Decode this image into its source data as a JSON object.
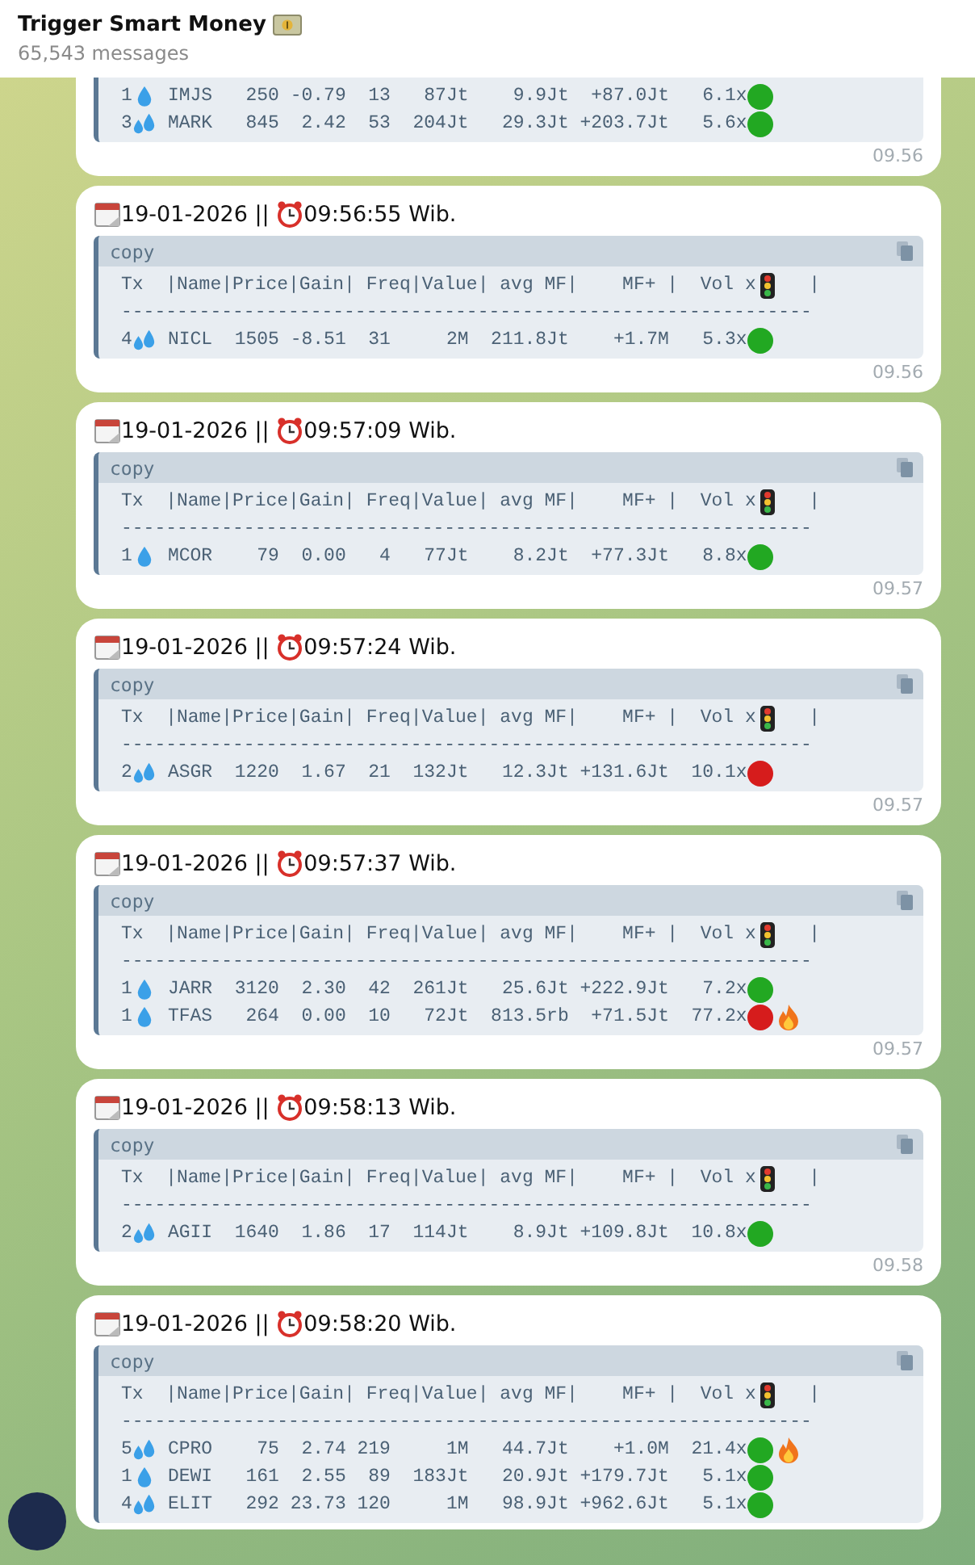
{
  "chat": {
    "title": "Trigger Smart Money",
    "subtitle": "65,543 messages"
  },
  "messages": [
    {
      "partial": true,
      "rows": [
        {
          "tx": "1",
          "kind": "drop",
          "name": "IMJS",
          "price": "250",
          "gain": "-0.79",
          "freq": "13",
          "value": "87Jt",
          "avg_mf": "9.9Jt",
          "mf_plus": "+87.0Jt",
          "vol": "6.1x",
          "color": "#22a822",
          "fire": false
        },
        {
          "tx": "3",
          "kind": "splash",
          "name": "MARK",
          "price": "845",
          "gain": "2.42",
          "freq": "53",
          "value": "204Jt",
          "avg_mf": "29.3Jt",
          "mf_plus": "+203.7Jt",
          "vol": "5.6x",
          "color": "#22a822",
          "fire": false
        }
      ],
      "sent": "09.56"
    },
    {
      "partial": false,
      "date": "19-01-2026 ||",
      "time": "09:56:55 Wib.",
      "copy_label": "copy",
      "header": "Tx  |Name|Price|Gain| Freq|Value| avg MF|    MF+ |  Vol x",
      "header_end": "   |",
      "rule": "--------------------------------------------------------------",
      "rows": [
        {
          "tx": "4",
          "kind": "splash",
          "name": "NICL",
          "price": "1505",
          "gain": "-8.51",
          "freq": "31",
          "value": "2M",
          "avg_mf": "211.8Jt",
          "mf_plus": "+1.7M",
          "vol": "5.3x",
          "color": "#22a822",
          "fire": false
        }
      ],
      "sent": "09.56"
    },
    {
      "partial": false,
      "date": "19-01-2026 ||",
      "time": "09:57:09 Wib.",
      "copy_label": "copy",
      "header": "Tx  |Name|Price|Gain| Freq|Value| avg MF|    MF+ |  Vol x",
      "header_end": "   |",
      "rule": "--------------------------------------------------------------",
      "rows": [
        {
          "tx": "1",
          "kind": "drop",
          "name": "MCOR",
          "price": "79",
          "gain": "0.00",
          "freq": "4",
          "value": "77Jt",
          "avg_mf": "8.2Jt",
          "mf_plus": "+77.3Jt",
          "vol": "8.8x",
          "color": "#22a822",
          "fire": false
        }
      ],
      "sent": "09.57"
    },
    {
      "partial": false,
      "date": "19-01-2026 ||",
      "time": "09:57:24 Wib.",
      "copy_label": "copy",
      "header": "Tx  |Name|Price|Gain| Freq|Value| avg MF|    MF+ |  Vol x",
      "header_end": "   |",
      "rule": "--------------------------------------------------------------",
      "rows": [
        {
          "tx": "2",
          "kind": "splash",
          "name": "ASGR",
          "price": "1220",
          "gain": "1.67",
          "freq": "21",
          "value": "132Jt",
          "avg_mf": "12.3Jt",
          "mf_plus": "+131.6Jt",
          "vol": "10.1x",
          "color": "#d61c1c",
          "fire": false
        }
      ],
      "sent": "09.57"
    },
    {
      "partial": false,
      "date": "19-01-2026 ||",
      "time": "09:57:37 Wib.",
      "copy_label": "copy",
      "header": "Tx  |Name|Price|Gain| Freq|Value| avg MF|    MF+ |  Vol x",
      "header_end": "   |",
      "rule": "--------------------------------------------------------------",
      "rows": [
        {
          "tx": "1",
          "kind": "drop",
          "name": "JARR",
          "price": "3120",
          "gain": "2.30",
          "freq": "42",
          "value": "261Jt",
          "avg_mf": "25.6Jt",
          "mf_plus": "+222.9Jt",
          "vol": "7.2x",
          "color": "#22a822",
          "fire": false
        },
        {
          "tx": "1",
          "kind": "drop",
          "name": "TFAS",
          "price": "264",
          "gain": "0.00",
          "freq": "10",
          "value": "72Jt",
          "avg_mf": "813.5rb",
          "mf_plus": "+71.5Jt",
          "vol": "77.2x",
          "color": "#d61c1c",
          "fire": true
        }
      ],
      "sent": "09.57"
    },
    {
      "partial": false,
      "date": "19-01-2026 ||",
      "time": "09:58:13 Wib.",
      "copy_label": "copy",
      "header": "Tx  |Name|Price|Gain| Freq|Value| avg MF|    MF+ |  Vol x",
      "header_end": "   |",
      "rule": "--------------------------------------------------------------",
      "rows": [
        {
          "tx": "2",
          "kind": "splash",
          "name": "AGII",
          "price": "1640",
          "gain": "1.86",
          "freq": "17",
          "value": "114Jt",
          "avg_mf": "8.9Jt",
          "mf_plus": "+109.8Jt",
          "vol": "10.8x",
          "color": "#22a822",
          "fire": false
        }
      ],
      "sent": "09.58"
    },
    {
      "partial": false,
      "date": "19-01-2026 ||",
      "time": "09:58:20 Wib.",
      "copy_label": "copy",
      "header": "Tx  |Name|Price|Gain| Freq|Value| avg MF|    MF+ |  Vol x",
      "header_end": "   |",
      "rule": "--------------------------------------------------------------",
      "rows": [
        {
          "tx": "5",
          "kind": "splash",
          "name": "CPRO",
          "price": "75",
          "gain": "2.74",
          "freq": "219",
          "value": "1M",
          "avg_mf": "44.7Jt",
          "mf_plus": "+1.0M",
          "vol": "21.4x",
          "color": "#22a822",
          "fire": true
        },
        {
          "tx": "1",
          "kind": "drop",
          "name": "DEWI",
          "price": "161",
          "gain": "2.55",
          "freq": "89",
          "value": "183Jt",
          "avg_mf": "20.9Jt",
          "mf_plus": "+179.7Jt",
          "vol": "5.1x",
          "color": "#22a822",
          "fire": false
        },
        {
          "tx": "4",
          "kind": "splash",
          "name": "ELIT",
          "price": "292",
          "gain": "23.73",
          "freq": "120",
          "value": "1M",
          "avg_mf": "98.9Jt",
          "mf_plus": "+962.6Jt",
          "vol": "5.1x",
          "color": "#22a822",
          "fire": false
        }
      ]
    }
  ]
}
